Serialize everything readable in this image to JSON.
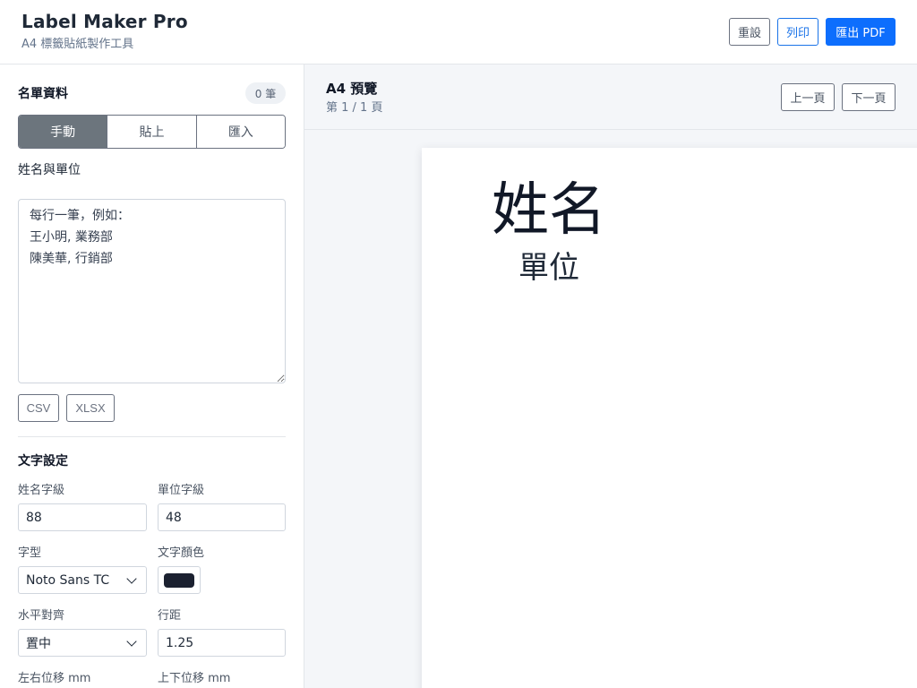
{
  "app": {
    "title": "Label Maker Pro",
    "subtitle": "A4 標籤貼紙製作工具"
  },
  "header_actions": {
    "reset": "重設",
    "print": "列印",
    "export": "匯出 PDF"
  },
  "sidebar": {
    "list_section": {
      "title": "名單資料",
      "count": "0 筆",
      "tabs": [
        {
          "label": "手動",
          "active": true
        },
        {
          "label": "貼上",
          "active": false
        },
        {
          "label": "匯入",
          "active": false
        }
      ],
      "field_label": "姓名與單位",
      "textarea_placeholder": "每行一筆，例如：\n王小明, 業務部\n陳美華, 行銷部",
      "textarea_value": "",
      "file_buttons": {
        "csv": "CSV",
        "xlsx": "XLSX"
      }
    },
    "text_settings": {
      "title": "文字設定",
      "name_size_label": "姓名字級",
      "name_size_value": "88",
      "dept_size_label": "單位字級",
      "dept_size_value": "48",
      "font_label": "字型",
      "font_value": "Noto Sans TC",
      "color_label": "文字顏色",
      "color_value": "#1b2130",
      "align_label": "水平對齊",
      "align_value": "置中",
      "line_height_label": "行距",
      "line_height_value": "1.25",
      "offset_x_label": "左右位移 mm",
      "offset_y_label": "上下位移 mm"
    }
  },
  "preview": {
    "title": "A4 預覽",
    "page_indicator": "第 1 / 1 頁",
    "prev_label": "上一頁",
    "next_label": "下一頁",
    "label_name": "姓名",
    "label_dept": "單位"
  },
  "icons": {
    "select_chevron": "chevron-down-icon"
  },
  "colors": {
    "primary": "#0d6efd",
    "active_tab": "#6c757d"
  }
}
